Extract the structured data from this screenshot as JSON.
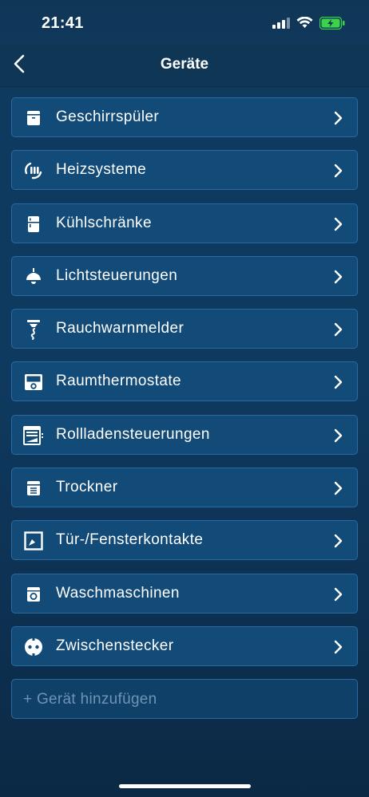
{
  "status_bar": {
    "time": "21:41",
    "icons": [
      "cellular-signal-icon",
      "wifi-icon",
      "battery-charging-icon"
    ],
    "battery_color": "#3ad34a"
  },
  "nav": {
    "title": "Geräte",
    "back_icon": "chevron-left-icon"
  },
  "devices": [
    {
      "label": "Geschirrspüler",
      "icon": "dishwasher-icon"
    },
    {
      "label": "Heizsysteme",
      "icon": "heating-icon"
    },
    {
      "label": "Kühlschränke",
      "icon": "fridge-icon"
    },
    {
      "label": "Lichtsteuerungen",
      "icon": "ceiling-lamp-icon"
    },
    {
      "label": "Rauchwarnmelder",
      "icon": "smoke-detector-icon"
    },
    {
      "label": "Raumthermostate",
      "icon": "room-thermostat-icon"
    },
    {
      "label": "Rollladensteuerungen",
      "icon": "roller-shutter-icon"
    },
    {
      "label": "Trockner",
      "icon": "dryer-icon"
    },
    {
      "label": "Tür-/Fensterkontakte",
      "icon": "door-window-contact-icon"
    },
    {
      "label": "Waschmaschinen",
      "icon": "washing-machine-icon"
    },
    {
      "label": "Zwischenstecker",
      "icon": "smart-plug-icon"
    }
  ],
  "add_device": {
    "label": "+ Gerät hinzufügen"
  },
  "colors": {
    "row_background": "#124a78",
    "row_border": "#2a6aa3",
    "placeholder_text": "#6f93b6"
  }
}
